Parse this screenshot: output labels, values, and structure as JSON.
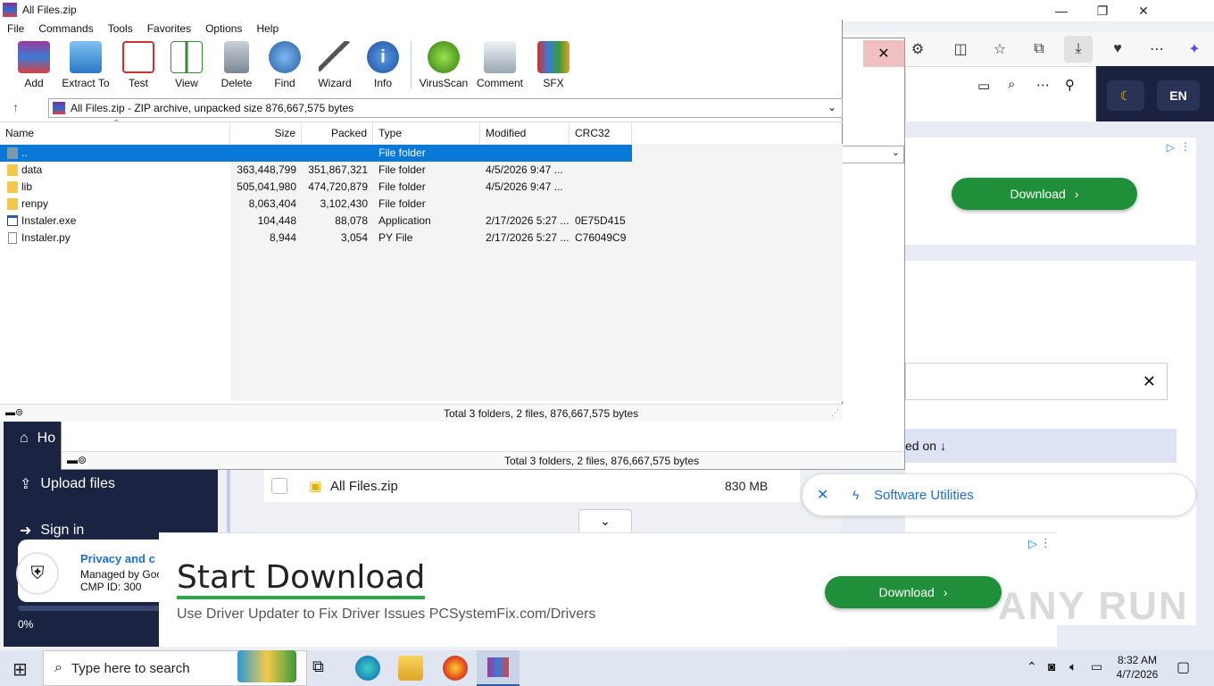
{
  "winrar": {
    "title": "All Files.zip",
    "menu": [
      "File",
      "Commands",
      "Tools",
      "Favorites",
      "Options",
      "Help"
    ],
    "toolbar": [
      "Add",
      "Extract To",
      "Test",
      "View",
      "Delete",
      "Find",
      "Wizard",
      "Info",
      "VirusScan",
      "Comment",
      "SFX"
    ],
    "path": "All Files.zip - ZIP archive, unpacked size 876,667,575 bytes",
    "columns": [
      "Name",
      "Size",
      "Packed",
      "Type",
      "Modified",
      "CRC32"
    ],
    "rows": [
      {
        "name": "..",
        "size": "",
        "packed": "",
        "type": "File folder",
        "modified": "",
        "crc": ""
      },
      {
        "name": "data",
        "size": "363,448,799",
        "packed": "351,867,321",
        "type": "File folder",
        "modified": "4/5/2026 9:47 ...",
        "crc": ""
      },
      {
        "name": "lib",
        "size": "505,041,980",
        "packed": "474,720,879",
        "type": "File folder",
        "modified": "4/5/2026 9:47 ...",
        "crc": ""
      },
      {
        "name": "renpy",
        "size": "8,063,404",
        "packed": "3,102,430",
        "type": "File folder",
        "modified": "",
        "crc": ""
      },
      {
        "name": "Instaler.exe",
        "size": "104,448",
        "packed": "88,078",
        "type": "Application",
        "modified": "2/17/2026 5:27 ...",
        "crc": "0E75D415"
      },
      {
        "name": "Instaler.py",
        "size": "8,944",
        "packed": "3,054",
        "type": "PY File",
        "modified": "2/17/2026 5:27 ...",
        "crc": "C76049C9"
      }
    ],
    "status": "Total 3 folders, 2 files, 876,667,575 bytes"
  },
  "winrar_back": {
    "status": "Total 3 folders, 2 files, 876,667,575 bytes"
  },
  "browser": {
    "header_en": "EN",
    "download_label": "Download",
    "sorted_label": "ed on",
    "sidebar": {
      "home": "Ho",
      "upload": "Upload files",
      "signin": "Sign in",
      "progress": "0%"
    },
    "file_name": "All Files.zip",
    "file_size": "830 MB",
    "privacy_title": "Privacy and c",
    "privacy_managed": "Managed by Goo",
    "privacy_cmp": "CMP ID: 300",
    "utility_label": "Software Utilities",
    "ad_title": "Start Download",
    "ad_subtitle": "Use Driver Updater to Fix Driver Issues PCSystemFix.com/Drivers",
    "ad_button": "Download",
    "watermark": "ANY RUN"
  },
  "taskbar": {
    "search_placeholder": "Type here to search",
    "time": "8:32 AM",
    "date": "4/7/2026"
  }
}
